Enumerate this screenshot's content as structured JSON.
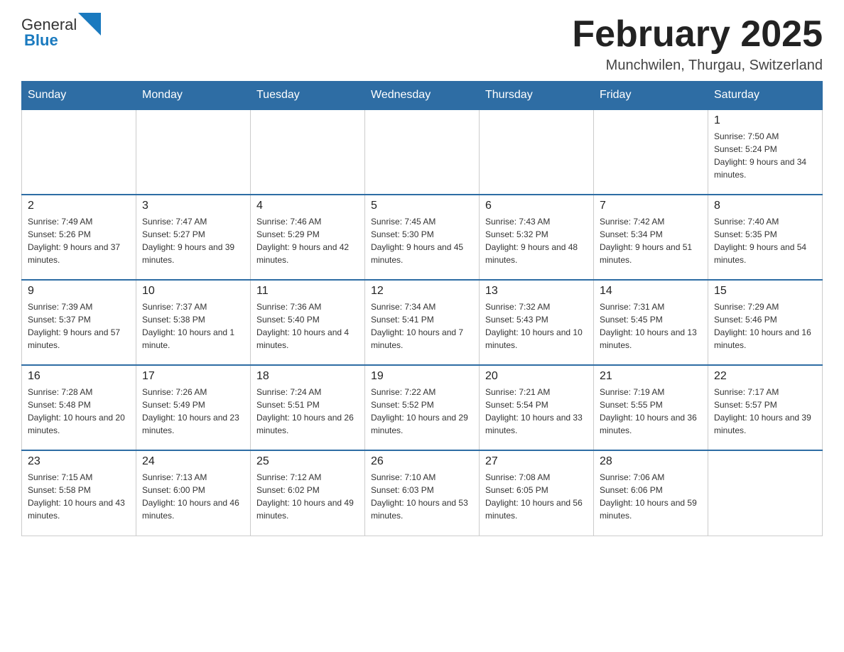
{
  "header": {
    "logo_text_general": "General",
    "logo_text_blue": "Blue",
    "month_title": "February 2025",
    "location": "Munchwilen, Thurgau, Switzerland"
  },
  "weekdays": [
    "Sunday",
    "Monday",
    "Tuesday",
    "Wednesday",
    "Thursday",
    "Friday",
    "Saturday"
  ],
  "weeks": [
    [
      {
        "day": "",
        "info": ""
      },
      {
        "day": "",
        "info": ""
      },
      {
        "day": "",
        "info": ""
      },
      {
        "day": "",
        "info": ""
      },
      {
        "day": "",
        "info": ""
      },
      {
        "day": "",
        "info": ""
      },
      {
        "day": "1",
        "info": "Sunrise: 7:50 AM\nSunset: 5:24 PM\nDaylight: 9 hours and 34 minutes."
      }
    ],
    [
      {
        "day": "2",
        "info": "Sunrise: 7:49 AM\nSunset: 5:26 PM\nDaylight: 9 hours and 37 minutes."
      },
      {
        "day": "3",
        "info": "Sunrise: 7:47 AM\nSunset: 5:27 PM\nDaylight: 9 hours and 39 minutes."
      },
      {
        "day": "4",
        "info": "Sunrise: 7:46 AM\nSunset: 5:29 PM\nDaylight: 9 hours and 42 minutes."
      },
      {
        "day": "5",
        "info": "Sunrise: 7:45 AM\nSunset: 5:30 PM\nDaylight: 9 hours and 45 minutes."
      },
      {
        "day": "6",
        "info": "Sunrise: 7:43 AM\nSunset: 5:32 PM\nDaylight: 9 hours and 48 minutes."
      },
      {
        "day": "7",
        "info": "Sunrise: 7:42 AM\nSunset: 5:34 PM\nDaylight: 9 hours and 51 minutes."
      },
      {
        "day": "8",
        "info": "Sunrise: 7:40 AM\nSunset: 5:35 PM\nDaylight: 9 hours and 54 minutes."
      }
    ],
    [
      {
        "day": "9",
        "info": "Sunrise: 7:39 AM\nSunset: 5:37 PM\nDaylight: 9 hours and 57 minutes."
      },
      {
        "day": "10",
        "info": "Sunrise: 7:37 AM\nSunset: 5:38 PM\nDaylight: 10 hours and 1 minute."
      },
      {
        "day": "11",
        "info": "Sunrise: 7:36 AM\nSunset: 5:40 PM\nDaylight: 10 hours and 4 minutes."
      },
      {
        "day": "12",
        "info": "Sunrise: 7:34 AM\nSunset: 5:41 PM\nDaylight: 10 hours and 7 minutes."
      },
      {
        "day": "13",
        "info": "Sunrise: 7:32 AM\nSunset: 5:43 PM\nDaylight: 10 hours and 10 minutes."
      },
      {
        "day": "14",
        "info": "Sunrise: 7:31 AM\nSunset: 5:45 PM\nDaylight: 10 hours and 13 minutes."
      },
      {
        "day": "15",
        "info": "Sunrise: 7:29 AM\nSunset: 5:46 PM\nDaylight: 10 hours and 16 minutes."
      }
    ],
    [
      {
        "day": "16",
        "info": "Sunrise: 7:28 AM\nSunset: 5:48 PM\nDaylight: 10 hours and 20 minutes."
      },
      {
        "day": "17",
        "info": "Sunrise: 7:26 AM\nSunset: 5:49 PM\nDaylight: 10 hours and 23 minutes."
      },
      {
        "day": "18",
        "info": "Sunrise: 7:24 AM\nSunset: 5:51 PM\nDaylight: 10 hours and 26 minutes."
      },
      {
        "day": "19",
        "info": "Sunrise: 7:22 AM\nSunset: 5:52 PM\nDaylight: 10 hours and 29 minutes."
      },
      {
        "day": "20",
        "info": "Sunrise: 7:21 AM\nSunset: 5:54 PM\nDaylight: 10 hours and 33 minutes."
      },
      {
        "day": "21",
        "info": "Sunrise: 7:19 AM\nSunset: 5:55 PM\nDaylight: 10 hours and 36 minutes."
      },
      {
        "day": "22",
        "info": "Sunrise: 7:17 AM\nSunset: 5:57 PM\nDaylight: 10 hours and 39 minutes."
      }
    ],
    [
      {
        "day": "23",
        "info": "Sunrise: 7:15 AM\nSunset: 5:58 PM\nDaylight: 10 hours and 43 minutes."
      },
      {
        "day": "24",
        "info": "Sunrise: 7:13 AM\nSunset: 6:00 PM\nDaylight: 10 hours and 46 minutes."
      },
      {
        "day": "25",
        "info": "Sunrise: 7:12 AM\nSunset: 6:02 PM\nDaylight: 10 hours and 49 minutes."
      },
      {
        "day": "26",
        "info": "Sunrise: 7:10 AM\nSunset: 6:03 PM\nDaylight: 10 hours and 53 minutes."
      },
      {
        "day": "27",
        "info": "Sunrise: 7:08 AM\nSunset: 6:05 PM\nDaylight: 10 hours and 56 minutes."
      },
      {
        "day": "28",
        "info": "Sunrise: 7:06 AM\nSunset: 6:06 PM\nDaylight: 10 hours and 59 minutes."
      },
      {
        "day": "",
        "info": ""
      }
    ]
  ]
}
